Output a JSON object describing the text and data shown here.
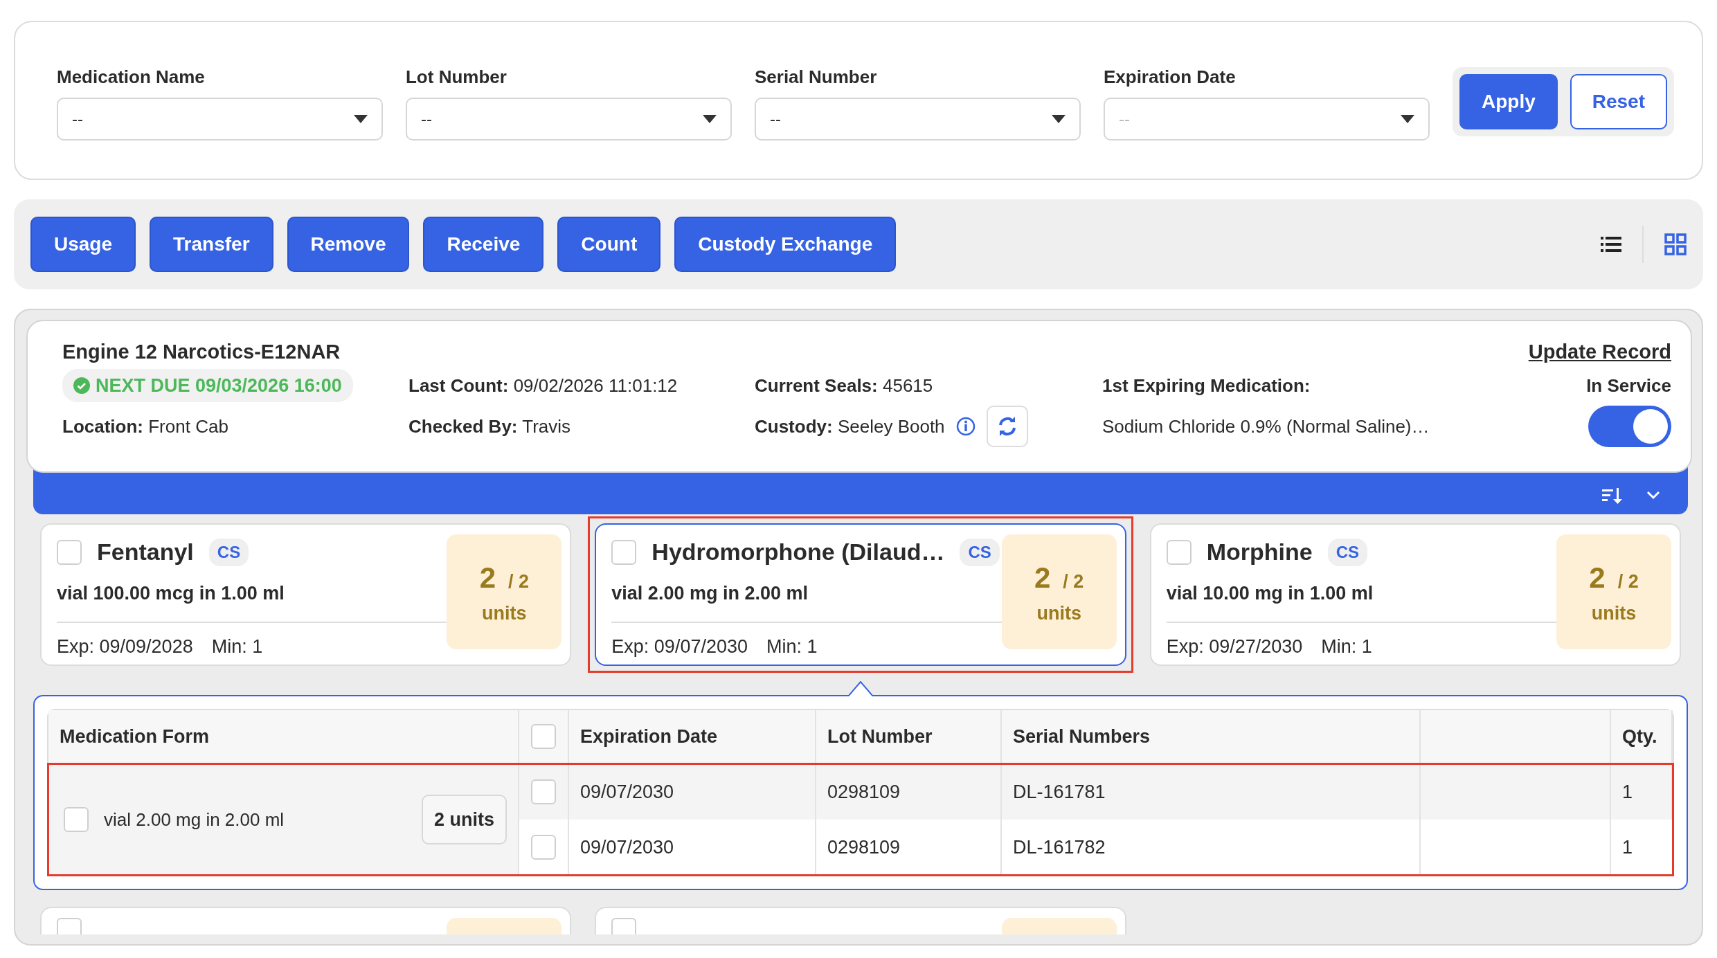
{
  "filters": [
    {
      "label": "Medication Name",
      "value": "--"
    },
    {
      "label": "Lot Number",
      "value": "--"
    },
    {
      "label": "Serial Number",
      "value": "--"
    },
    {
      "label": "Expiration Date",
      "placeholder": "--"
    }
  ],
  "filter_buttons": [
    {
      "label": "Apply",
      "kind": "primary"
    },
    {
      "label": "Reset",
      "kind": "outline"
    }
  ],
  "actions": [
    "Usage",
    "Transfer",
    "Remove",
    "Receive",
    "Count",
    "Custody Exchange"
  ],
  "view_toggle": [
    {
      "kind": "list",
      "selected": false
    },
    {
      "kind": "grid",
      "selected": true
    }
  ],
  "location": {
    "title": "Engine 12 Narcotics-E12NAR",
    "next_due": "NEXT DUE 09/03/2026 16:00",
    "location_label": "Location:",
    "location_value": "Front Cab",
    "last_count_label": "Last Count:",
    "last_count_value": "09/02/2026 11:01:12",
    "checked_by_label": "Checked By:",
    "checked_by_value": "Travis",
    "seals_label": "Current Seals:",
    "seals_value": "45615",
    "custody_label": "Custody:",
    "custody_value": "Seeley Booth",
    "expiring_label": "1st Expiring Medication:",
    "expiring_value": "Sodium Chloride 0.9% (Normal Saline)…",
    "update_link": "Update Record",
    "service_label": "In Service",
    "in_service": true
  },
  "medications": [
    {
      "name": "Fentanyl",
      "badge": "CS",
      "form": "vial 100.00 mcg in 1.00 ml",
      "exp": "Exp: 09/09/2028",
      "min": "Min: 1",
      "count": "2",
      "total": "/ 2",
      "unit": "units",
      "checked": false,
      "selected": false,
      "highlighted": false
    },
    {
      "name": "Hydromorphone (Dilaud…",
      "badge": "CS",
      "form": "vial 2.00 mg in 2.00 ml",
      "exp": "Exp: 09/07/2030",
      "min": "Min: 1",
      "count": "2",
      "total": "/ 2",
      "unit": "units",
      "checked": false,
      "selected": true,
      "highlighted": true
    },
    {
      "name": "Morphine",
      "badge": "CS",
      "form": "vial 10.00 mg in 1.00 ml",
      "exp": "Exp: 09/27/2030",
      "min": "Min: 1",
      "count": "2",
      "total": "/ 2",
      "unit": "units",
      "checked": false,
      "selected": false,
      "highlighted": false
    },
    {
      "checked": false,
      "selected": false,
      "highlighted": false
    },
    {
      "checked": false,
      "selected": false,
      "highlighted": false
    }
  ],
  "detail": {
    "columns": [
      {
        "kind": "text",
        "label": "Medication Form"
      },
      {
        "kind": "checkbox",
        "checked": false
      },
      {
        "kind": "text",
        "label": "Expiration Date"
      },
      {
        "kind": "text",
        "label": "Lot Number"
      },
      {
        "kind": "text",
        "label": "Serial Numbers"
      },
      {
        "kind": "blank"
      },
      {
        "kind": "text",
        "label": "Qty."
      }
    ],
    "groups": [
      {
        "form": "vial 2.00 mg in 2.00 ml",
        "units": "2 units",
        "checked": false,
        "highlighted": true,
        "rows": [
          {
            "checked": false,
            "expiration": "09/07/2030",
            "lot": "0298109",
            "serial": "DL-161781",
            "qty": "1"
          },
          {
            "checked": false,
            "expiration": "09/07/2030",
            "lot": "0298109",
            "serial": "DL-161782",
            "qty": "1"
          }
        ]
      }
    ]
  }
}
